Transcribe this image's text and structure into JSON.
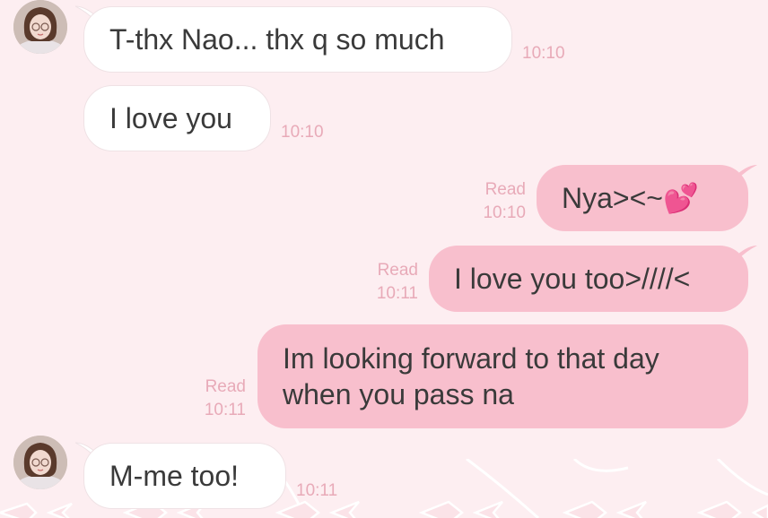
{
  "messages": [
    {
      "text": "T-thx Nao... thx q so much",
      "time": "10:10"
    },
    {
      "text": "I love you",
      "time": "10:10"
    },
    {
      "text": "Nya><~💕",
      "status": "Read",
      "time": "10:10"
    },
    {
      "text": "I love you too>////<",
      "status": "Read",
      "time": "10:11"
    },
    {
      "text_line1": "Im looking forward to that day",
      "text_line2": "when you pass na",
      "status": "Read",
      "time": "10:11"
    },
    {
      "text": "M-me too!",
      "time": "10:11"
    }
  ],
  "colors": {
    "background": "#fdeef1",
    "incoming_bubble": "#ffffff",
    "outgoing_bubble": "#f8bfcd",
    "timestamp": "#e8aab8",
    "text": "#3a3a3a"
  }
}
